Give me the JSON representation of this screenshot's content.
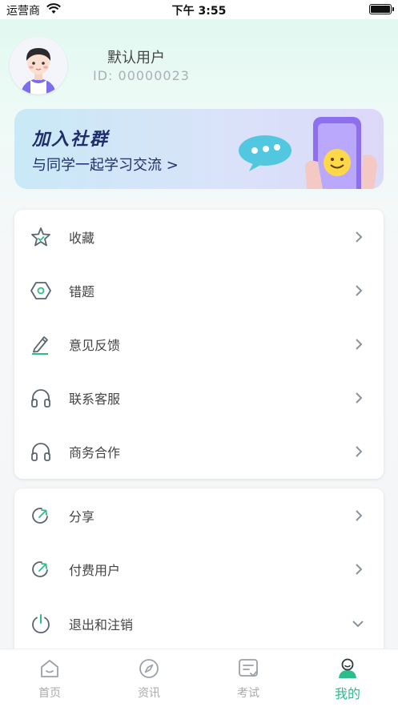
{
  "status_bar": {
    "carrier": "运营商",
    "time": "下午 3:55"
  },
  "profile": {
    "username": "默认用户",
    "id_text": "ID:  00000023"
  },
  "banner": {
    "title": "加入社群",
    "subtitle": "与同学一起学习交流 >"
  },
  "menu_group_1": [
    {
      "label": "收藏",
      "icon": "star-icon"
    },
    {
      "label": "错题",
      "icon": "hexagon-icon"
    },
    {
      "label": "意见反馈",
      "icon": "pencil-icon"
    },
    {
      "label": "联系客服",
      "icon": "headphones-icon"
    },
    {
      "label": "商务合作",
      "icon": "headphones-icon"
    }
  ],
  "menu_group_2": [
    {
      "label": "分享",
      "icon": "share-icon"
    },
    {
      "label": "付费用户",
      "icon": "share-icon"
    },
    {
      "label": "退出和注销",
      "icon": "power-icon"
    }
  ],
  "tabbar": {
    "tabs": [
      {
        "label": "首页",
        "icon": "home-icon"
      },
      {
        "label": "资讯",
        "icon": "compass-icon"
      },
      {
        "label": "考试",
        "icon": "exam-icon"
      },
      {
        "label": "我的",
        "icon": "user-icon",
        "active": true
      }
    ]
  },
  "colors": {
    "accent": "#2dbd8a",
    "icon": "#5a6570",
    "banner_text": "#1e2d6b"
  }
}
